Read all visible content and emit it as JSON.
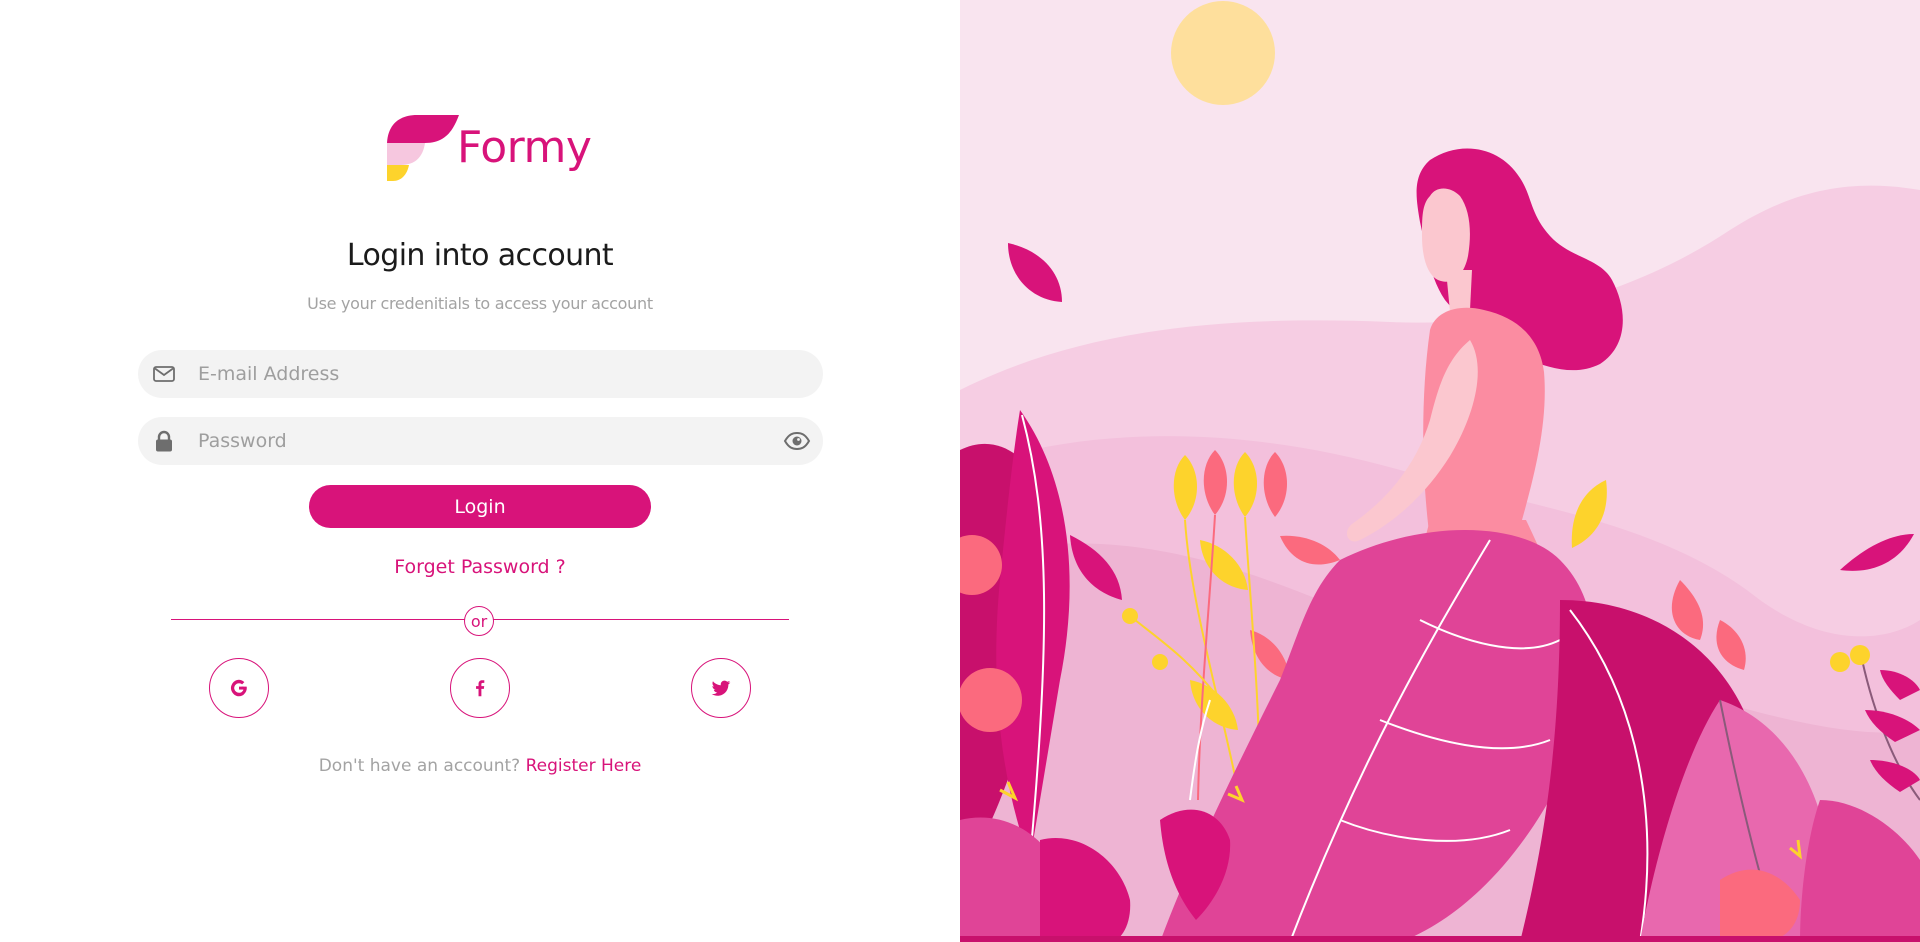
{
  "brand": {
    "name": "Formy",
    "primary_color": "#d8137a",
    "light_pink": "#f6c7df",
    "yellow": "#fdd32c"
  },
  "header": {
    "title": "Login into account",
    "subtitle": "Use your credenitials to access your account"
  },
  "form": {
    "email": {
      "placeholder": "E-mail Address",
      "value": "",
      "icon": "envelope-icon"
    },
    "password": {
      "placeholder": "Password",
      "value": "",
      "icon": "lock-icon",
      "toggle_icon": "eye-icon"
    },
    "login_label": "Login",
    "forgot_label": "Forget Password ?"
  },
  "divider": {
    "label": "or"
  },
  "social": [
    {
      "name": "google",
      "icon": "google-icon"
    },
    {
      "name": "facebook",
      "icon": "facebook-icon"
    },
    {
      "name": "twitter",
      "icon": "twitter-icon"
    }
  ],
  "footer": {
    "prompt": "Don't have an account?",
    "link_label": "Register Here"
  },
  "illustration": {
    "description_icon": "woman-in-flower-garden-illustration",
    "sun_color": "#fedf9c",
    "sky_color": "#f9e4ef"
  }
}
